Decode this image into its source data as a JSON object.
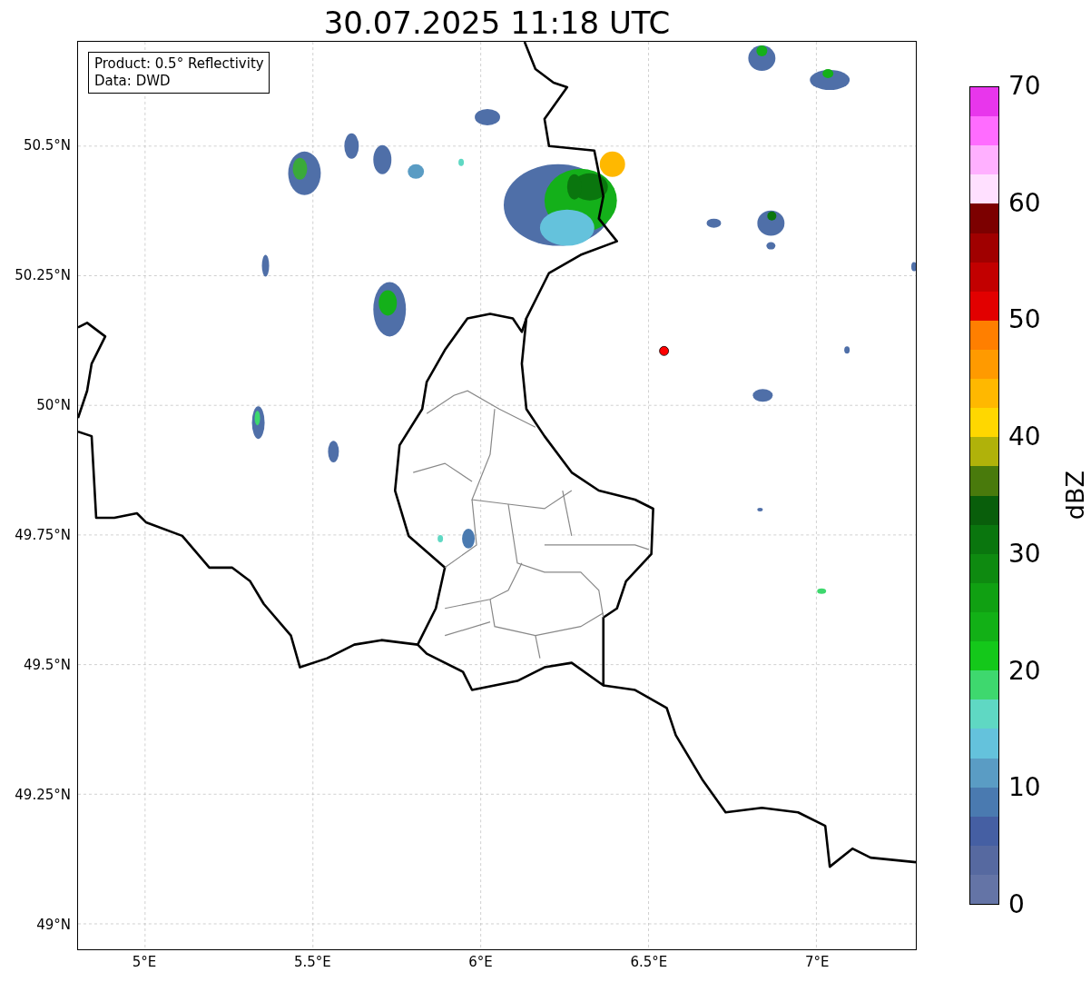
{
  "title": "30.07.2025 11:18 UTC",
  "map": {
    "info_box": [
      "Product: 0.5° Reflectivity",
      "Data: DWD"
    ],
    "y_ticks": [
      "50.5°N",
      "50.25°N",
      "50°N",
      "49.75°N",
      "49.5°N",
      "49.25°N",
      "49°N"
    ],
    "x_ticks": [
      "5°E",
      "5.5°E",
      "6°E",
      "6.5°E",
      "7°E"
    ]
  },
  "colorbar": {
    "label": "dBZ",
    "ticks": [
      "70",
      "60",
      "50",
      "40",
      "30",
      "20",
      "10",
      "0"
    ],
    "segments": [
      {
        "color": "#e836ec"
      },
      {
        "color": "#ff6cff"
      },
      {
        "color": "#ffb0ff"
      },
      {
        "color": "#ffe0ff"
      },
      {
        "color": "#7c0000"
      },
      {
        "color": "#a00000"
      },
      {
        "color": "#c20000"
      },
      {
        "color": "#e20000"
      },
      {
        "color": "#ff7f00"
      },
      {
        "color": "#ff9a00"
      },
      {
        "color": "#ffb800"
      },
      {
        "color": "#ffd700"
      },
      {
        "color": "#b0b20a"
      },
      {
        "color": "#497a0c"
      },
      {
        "color": "#095e0b"
      },
      {
        "color": "#0a760e"
      },
      {
        "color": "#0e8a10"
      },
      {
        "color": "#10a012"
      },
      {
        "color": "#12b016"
      },
      {
        "color": "#14c81a"
      },
      {
        "color": "#3ed86e"
      },
      {
        "color": "#5fd8c3"
      },
      {
        "color": "#64c2dc"
      },
      {
        "color": "#5a9cc4"
      },
      {
        "color": "#4a7ab0"
      },
      {
        "color": "#455fa3"
      },
      {
        "color": "#5669a0"
      },
      {
        "color": "#6474a6"
      }
    ]
  }
}
